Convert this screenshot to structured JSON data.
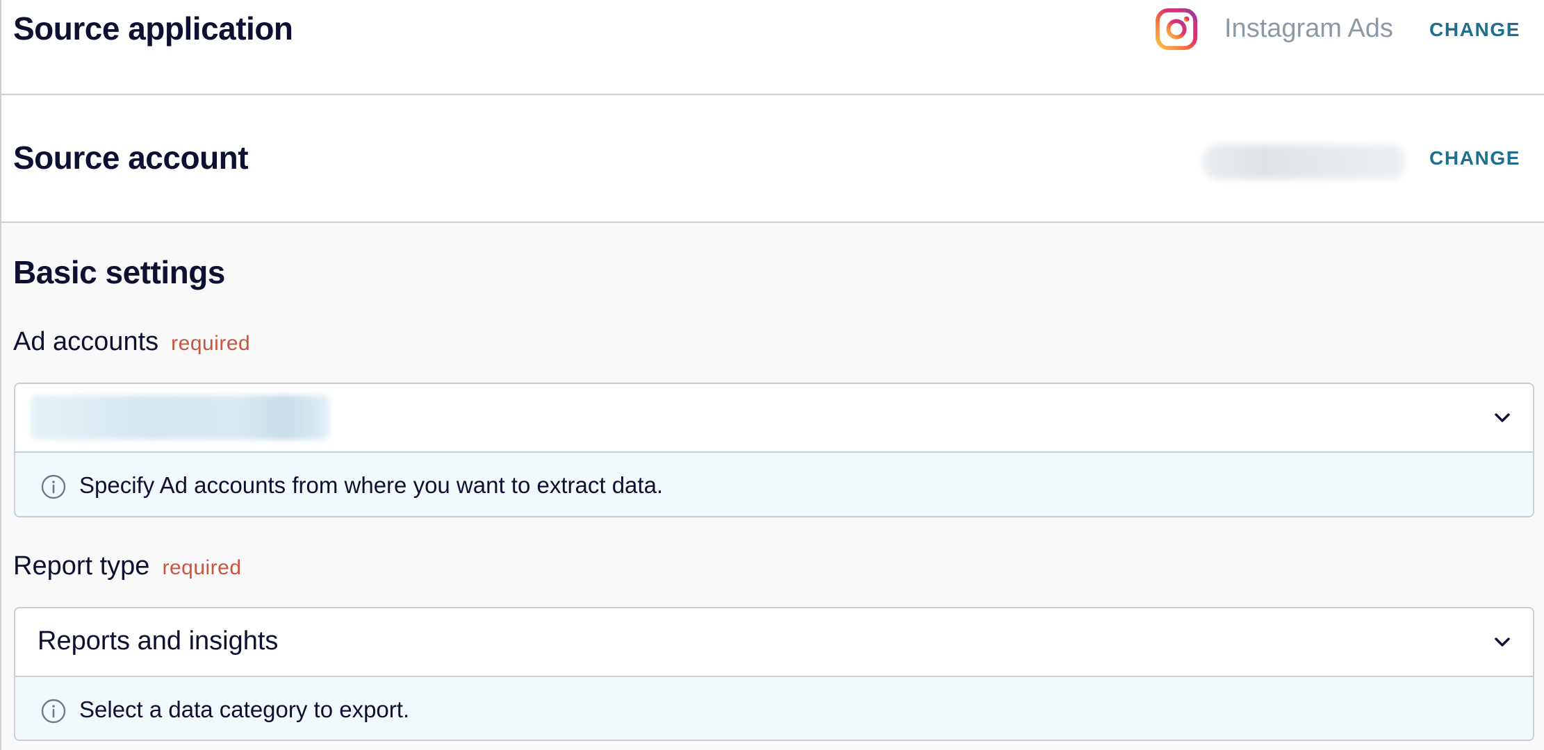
{
  "source_application": {
    "title": "Source application",
    "app_name": "Instagram Ads",
    "app_icon": "instagram-icon",
    "change_label": "CHANGE"
  },
  "source_account": {
    "title": "Source account",
    "change_label": "CHANGE"
  },
  "basic_settings": {
    "title": "Basic settings",
    "ad_accounts": {
      "label": "Ad accounts",
      "required": "required",
      "help": "Specify Ad accounts from where you want to extract data."
    },
    "report_type": {
      "label": "Report type",
      "required": "required",
      "value": "Reports and insights",
      "help": "Select a data category to export."
    }
  },
  "colors": {
    "accent": "#1e6f8f",
    "required": "#c8553f",
    "help_bg": "#f1f9fc",
    "text": "#0d1030"
  }
}
